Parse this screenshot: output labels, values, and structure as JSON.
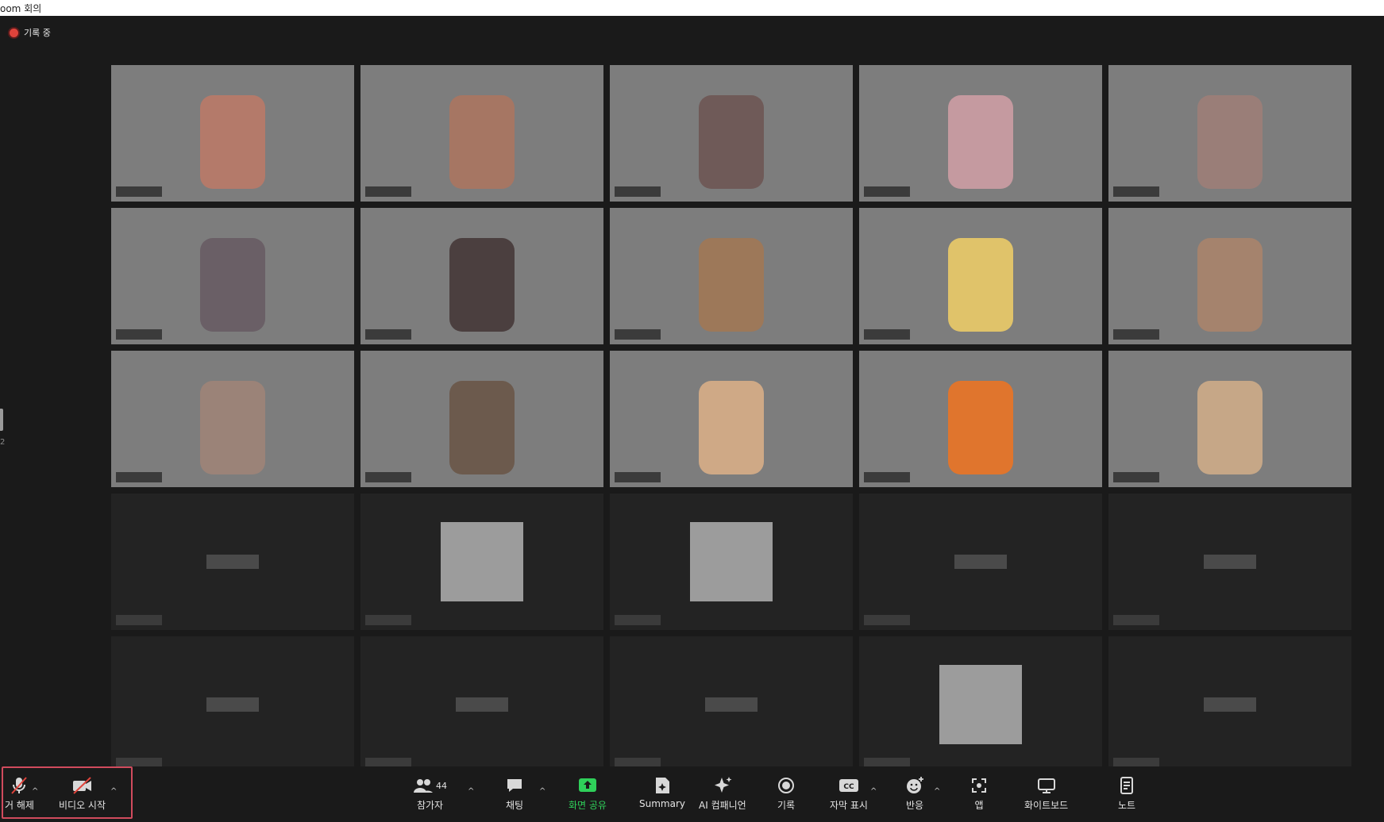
{
  "window": {
    "title": "oom 회의"
  },
  "recording": {
    "label": "기록 중"
  },
  "side_page": {
    "label": "2"
  },
  "participants_tiles": [
    {
      "kind": "video"
    },
    {
      "kind": "video"
    },
    {
      "kind": "video"
    },
    {
      "kind": "video"
    },
    {
      "kind": "video"
    },
    {
      "kind": "video"
    },
    {
      "kind": "video"
    },
    {
      "kind": "video"
    },
    {
      "kind": "video"
    },
    {
      "kind": "video"
    },
    {
      "kind": "video"
    },
    {
      "kind": "video"
    },
    {
      "kind": "video"
    },
    {
      "kind": "video"
    },
    {
      "kind": "video"
    },
    {
      "kind": "name"
    },
    {
      "kind": "photo"
    },
    {
      "kind": "photo"
    },
    {
      "kind": "name"
    },
    {
      "kind": "name"
    },
    {
      "kind": "name"
    },
    {
      "kind": "name"
    },
    {
      "kind": "name"
    },
    {
      "kind": "photo"
    },
    {
      "kind": "name"
    }
  ],
  "toolbar": {
    "mute": {
      "label": "거 해제",
      "icon": "microphone-muted-icon"
    },
    "video": {
      "label": "비디오 시작",
      "icon": "video-off-icon"
    },
    "participants": {
      "label": "참가자",
      "count": "44",
      "icon": "participants-icon"
    },
    "chat": {
      "label": "채팅",
      "icon": "chat-icon"
    },
    "share": {
      "label": "화면 공유",
      "icon": "share-screen-icon",
      "color": "#2fd05a"
    },
    "summary": {
      "label": "Summary",
      "icon": "summary-icon"
    },
    "ai": {
      "label": "AI 컴패니언",
      "icon": "ai-companion-icon"
    },
    "record": {
      "label": "기록",
      "icon": "record-icon"
    },
    "captions": {
      "label": "자막 표시",
      "icon": "captions-icon"
    },
    "reactions": {
      "label": "반응",
      "icon": "reaction-icon"
    },
    "apps": {
      "label": "앱",
      "icon": "apps-icon"
    },
    "whiteboard": {
      "label": "화이트보드",
      "icon": "whiteboard-icon"
    },
    "notes": {
      "label": "노트",
      "icon": "notes-icon"
    }
  },
  "colors": {
    "highlight": "#d14b5d",
    "recording": "#e0433b",
    "background": "#1a1a1a"
  }
}
